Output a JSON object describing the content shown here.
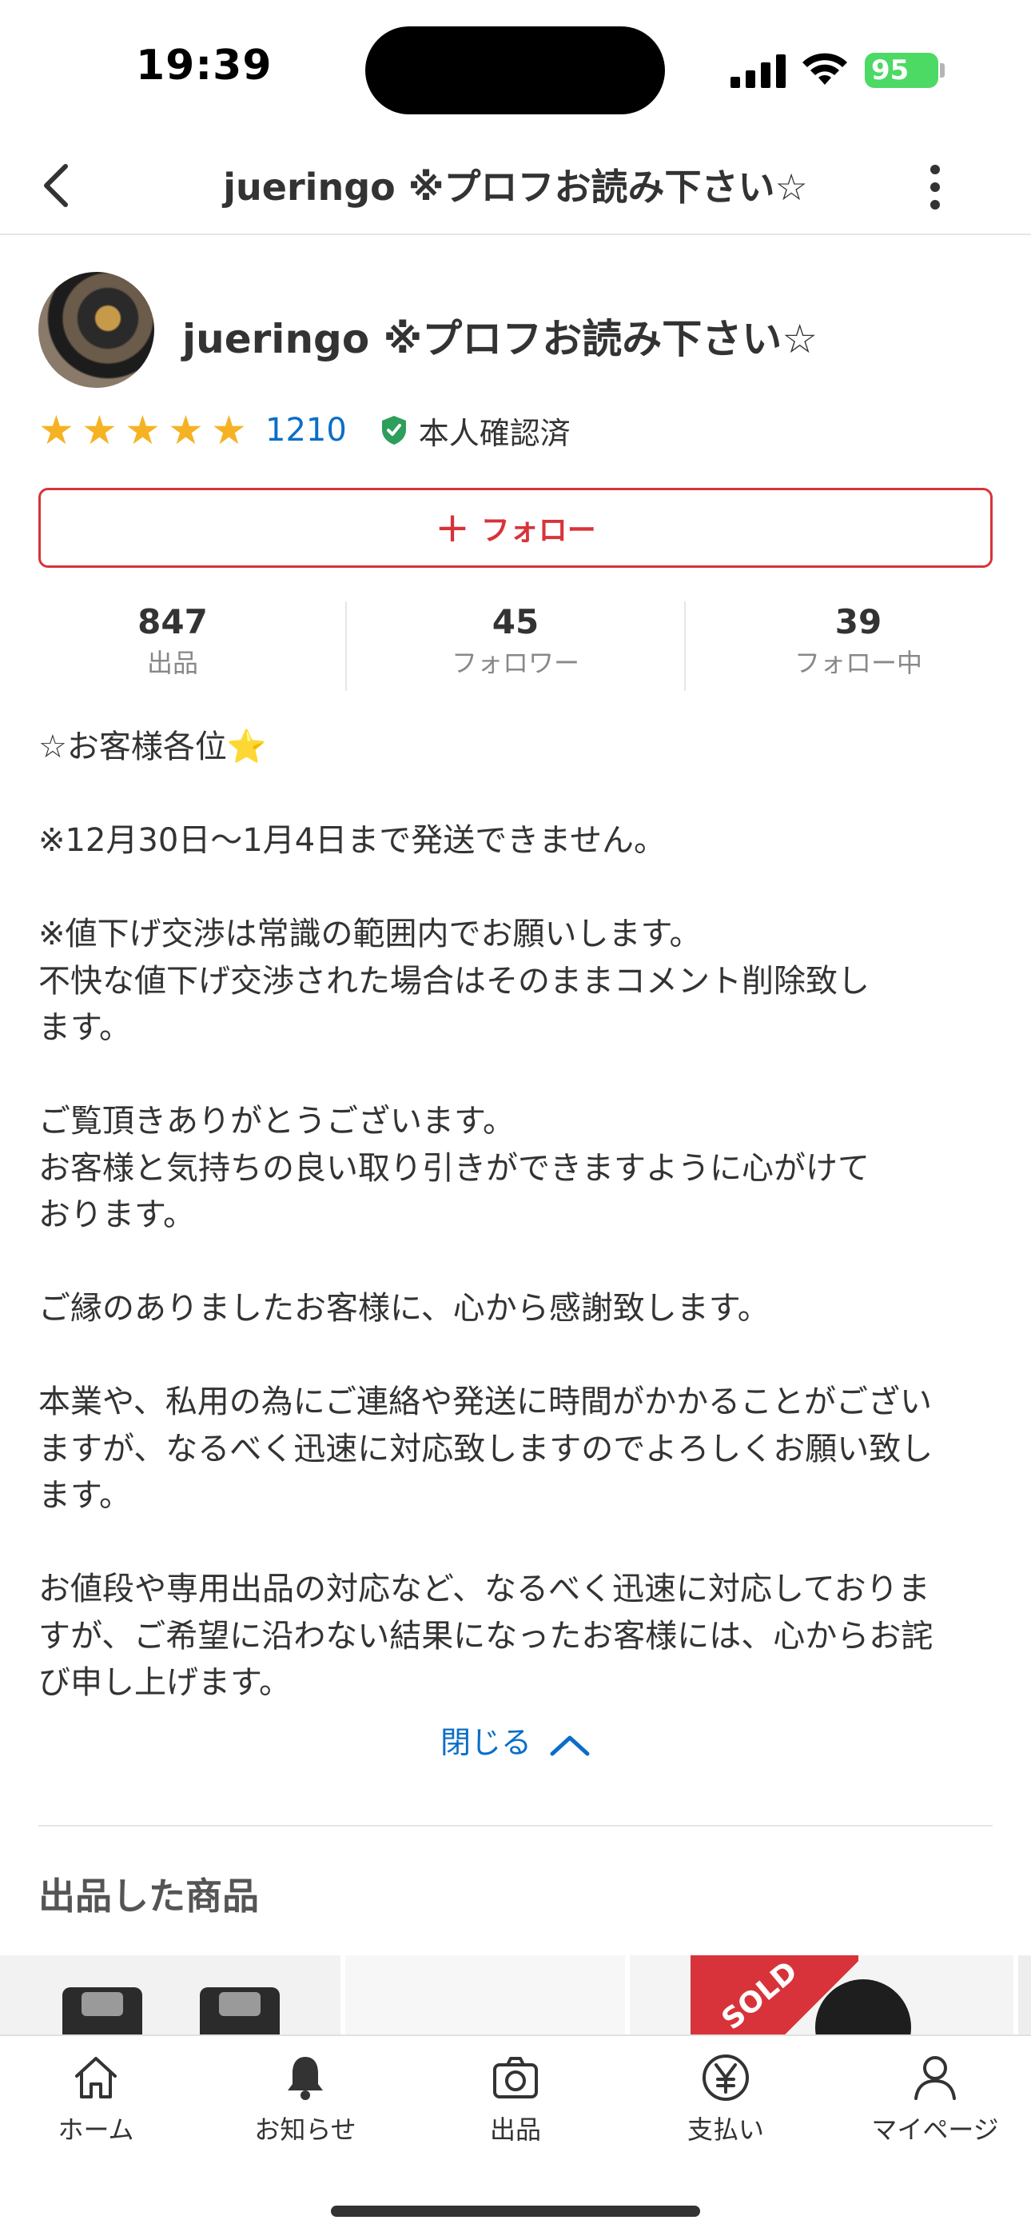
{
  "status_bar": {
    "time": "19:39",
    "battery": "95"
  },
  "header": {
    "title": "jueringo ※プロフお読み下さい☆"
  },
  "profile": {
    "username": "jueringo ※プロフお読み下さい☆",
    "rating_stars": 5,
    "review_count": "1210",
    "verified_label": "本人確認済",
    "follow_label": "フォロー",
    "stats": [
      {
        "value": "847",
        "label": "出品"
      },
      {
        "value": "45",
        "label": "フォロワー"
      },
      {
        "value": "39",
        "label": "フォロー中"
      }
    ]
  },
  "bio": "☆お客様各位⭐\n\n※12月30日〜1月4日まで発送できません。\n\n※値下げ交渉は常識の範囲内でお願いします。\n不快な値下げ交渉された場合はそのままコメント削除致し\nます。\n\nご覧頂きありがとうございます。\nお客様と気持ちの良い取り引きができますように心がけて\nおります。\n\nご縁のありましたお客様に、心から感謝致します。\n\n本業や、私用の為にご連絡や発送に時間がかかることがござい\nますが、なるべく迅速に対応致しますのでよろしくお願い致し\nます。\n\nお値段や専用出品の対応など、なるべく迅速に対応しておりま\nすが、ご希望に沿わない結果になったお客様には、心からお詫\nび申し上げます。",
  "close_label": "閉じる",
  "listings": {
    "title": "出品した商品",
    "sold_label": "SOLD"
  },
  "tabbar": {
    "items": [
      {
        "label": "ホーム",
        "icon": "home-icon"
      },
      {
        "label": "お知らせ",
        "icon": "bell-icon"
      },
      {
        "label": "出品",
        "icon": "camera-icon"
      },
      {
        "label": "支払い",
        "icon": "yen-icon"
      },
      {
        "label": "マイページ",
        "icon": "person-icon"
      }
    ]
  },
  "colors": {
    "accent": "#d8333a",
    "link": "#0a6ec8",
    "star": "#f5b324",
    "verified": "#2e9e5b"
  }
}
